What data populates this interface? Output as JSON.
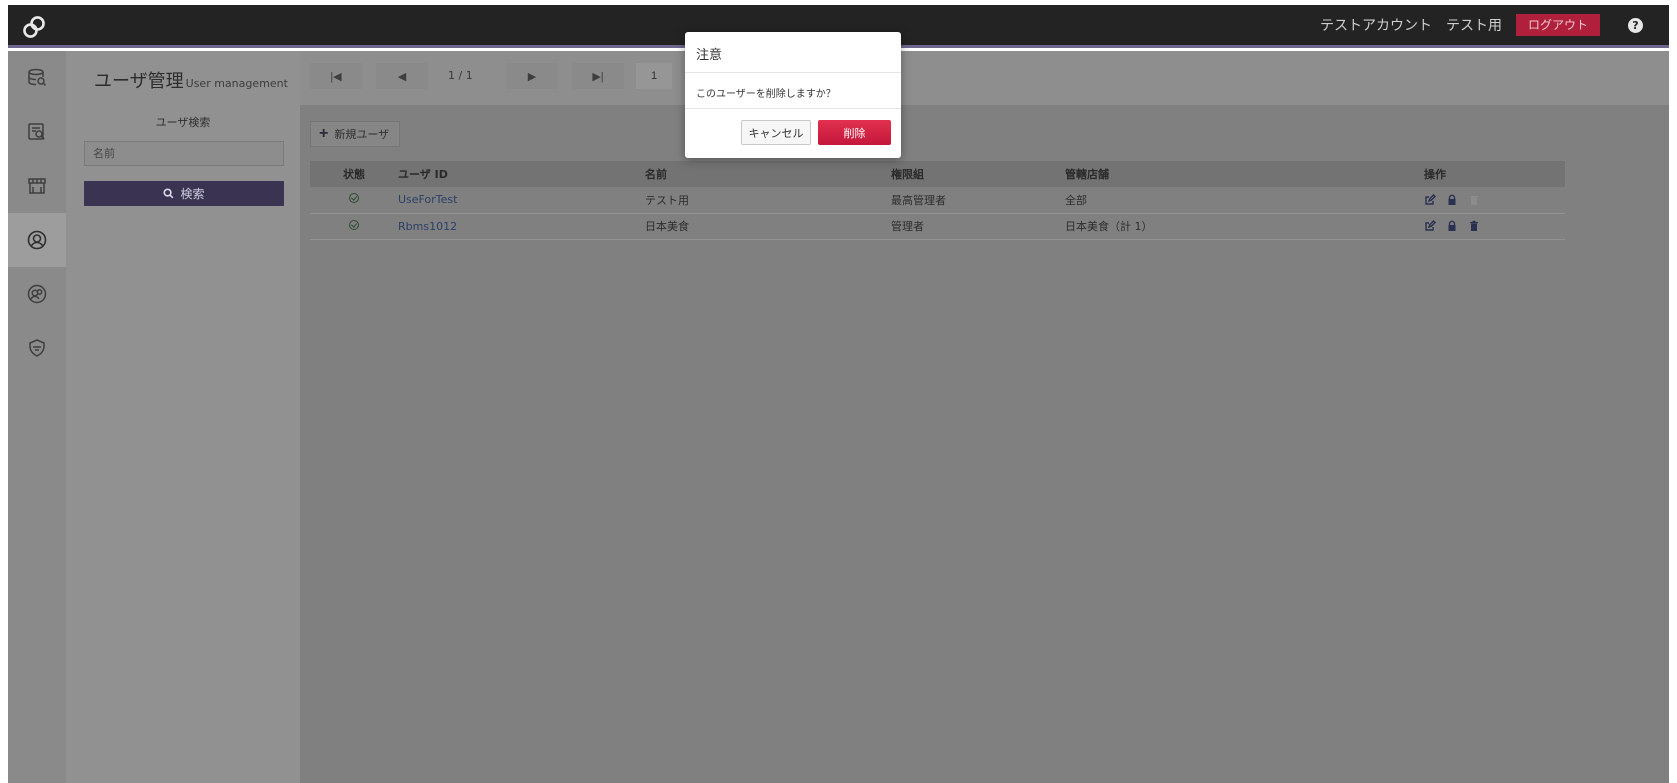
{
  "header": {
    "account_label": "テストアカウント",
    "user_label": "テスト用",
    "logout_label": "ログアウト",
    "help_glyph": "?"
  },
  "rail": {
    "items": [
      {
        "icon": "database-search-icon"
      },
      {
        "icon": "report-search-icon"
      },
      {
        "icon": "store-icon"
      },
      {
        "icon": "user-circle-icon",
        "active": true
      },
      {
        "icon": "user-group-icon"
      },
      {
        "icon": "shield-icon"
      }
    ]
  },
  "panel": {
    "title": "ユーザ管理",
    "title_en": "User management",
    "search_label": "ユーザ検索",
    "name_placeholder": "名前",
    "search_button": "検索"
  },
  "pager": {
    "first": "|◀",
    "prev": "◀",
    "page_info": "1 / 1",
    "next": "▶",
    "last": "▶|",
    "page_input": "1"
  },
  "toolbar": {
    "new_user_label": "新規ユーザ"
  },
  "table": {
    "columns": {
      "state": "状態",
      "user_id": "ユーザ ID",
      "name": "名前",
      "role": "権限組",
      "store": "管轄店舗",
      "ops": "操作"
    },
    "rows": [
      {
        "user_id": "UseForTest",
        "name": "テスト用",
        "role": "最高管理者",
        "store": "全部",
        "delete_enabled": false
      },
      {
        "user_id": "Rbms1012",
        "name": "日本美食",
        "role": "管理者",
        "store": "日本美食（計 1）",
        "delete_enabled": true
      }
    ]
  },
  "modal": {
    "title": "注意",
    "message": "このユーザーを削除しますか？",
    "cancel_label": "キャンセル",
    "delete_label": "削除"
  },
  "colors": {
    "accent_purple": "#3a3452",
    "danger_red": "#c3163a",
    "topbar": "#232323"
  }
}
